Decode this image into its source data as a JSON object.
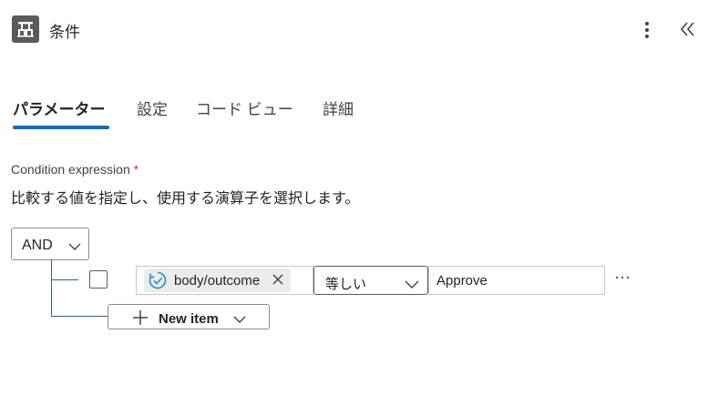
{
  "header": {
    "title": "条件",
    "icon": "condition-icon",
    "more_icon": "more-vertical-icon",
    "collapse_icon": "double-chevron-left-icon"
  },
  "tabs": [
    {
      "label": "パラメーター",
      "active": true
    },
    {
      "label": "設定",
      "active": false
    },
    {
      "label": "コード ビュー",
      "active": false
    },
    {
      "label": "詳細",
      "active": false
    }
  ],
  "condition": {
    "label": "Condition expression",
    "required_marker": "*",
    "description": "比較する値を指定し、使用する演算子を選択します。",
    "group_operator": "AND",
    "rows": [
      {
        "checked": false,
        "left_token": "body/outcome",
        "operator": "等しい",
        "right_value": "Approve"
      }
    ],
    "new_item_label": "New item"
  },
  "colors": {
    "accent": "#0f6cbd",
    "required": "#c4314b",
    "token_bg": "#ebebeb",
    "tree_line": "#2b5f8f"
  }
}
